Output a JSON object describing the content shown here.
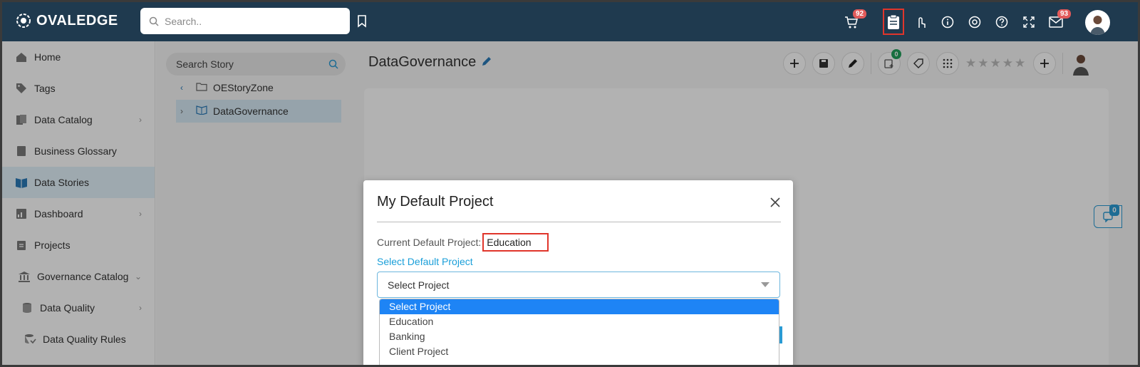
{
  "app": {
    "logo_text": "OVALEDGE"
  },
  "topbar": {
    "search_placeholder": "Search..",
    "cart_badge": "92",
    "mail_badge": "93",
    "icons": [
      "bookmark-icon",
      "cart-icon",
      "clipboard-icon",
      "touch-icon",
      "info-icon",
      "chrome-icon",
      "help-icon",
      "expand-icon",
      "mail-icon",
      "user-avatar"
    ]
  },
  "sidebar": {
    "items": [
      {
        "label": "Home",
        "icon": "home-icon"
      },
      {
        "label": "Tags",
        "icon": "tag-icon"
      },
      {
        "label": "Data Catalog",
        "icon": "catalog-icon",
        "chevron": "›"
      },
      {
        "label": "Business Glossary",
        "icon": "book-icon"
      },
      {
        "label": "Data Stories",
        "icon": "stories-icon"
      },
      {
        "label": "Dashboard",
        "icon": "dashboard-icon",
        "chevron": "›"
      },
      {
        "label": "Projects",
        "icon": "projects-icon"
      },
      {
        "label": "Governance Catalog",
        "icon": "bank-icon",
        "chevron": "⌄"
      },
      {
        "label": "Data Quality",
        "icon": "database-icon",
        "chevron": "›"
      },
      {
        "label": "Data Quality Rules",
        "icon": "rules-icon"
      }
    ]
  },
  "story_panel": {
    "search_placeholder": "Search Story",
    "tree": [
      {
        "label": "OEStoryZone"
      },
      {
        "label": "DataGovernance"
      }
    ]
  },
  "page": {
    "title": "DataGovernance",
    "action_badge": "0",
    "stars": "★★★★★",
    "side_tab_badge": "0"
  },
  "modal": {
    "title": "My Default Project",
    "current_label": "Current Default Project:",
    "current_value": "Education",
    "select_label": "Select Default Project",
    "select_value": "Select Project",
    "options": [
      "Select Project",
      "Education",
      "Banking",
      "Client Project"
    ],
    "highlighted_option": "Select Project"
  },
  "colors": {
    "topbar": "#1f3a4f",
    "accent": "#1a9fd9",
    "highlight_box": "#e0352b",
    "selected_option": "#1e84f5",
    "badge": "#e25a5a"
  }
}
